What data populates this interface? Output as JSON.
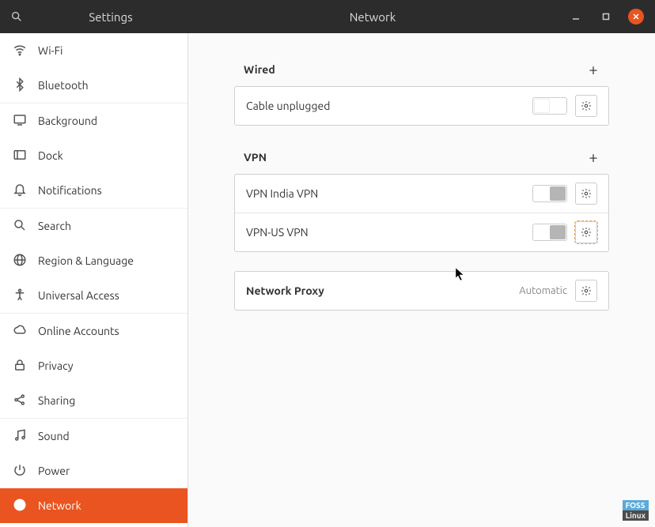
{
  "titlebar": {
    "app_title": "Settings",
    "page_title": "Network"
  },
  "sidebar": {
    "items": [
      {
        "icon": "wifi",
        "label": "Wi-Fi"
      },
      {
        "icon": "bluetooth",
        "label": "Bluetooth"
      },
      {
        "icon": "background",
        "label": "Background"
      },
      {
        "icon": "dock",
        "label": "Dock"
      },
      {
        "icon": "bell",
        "label": "Notifications"
      },
      {
        "icon": "search",
        "label": "Search"
      },
      {
        "icon": "globe",
        "label": "Region & Language"
      },
      {
        "icon": "accessibility",
        "label": "Universal Access"
      },
      {
        "icon": "cloud",
        "label": "Online Accounts"
      },
      {
        "icon": "lock",
        "label": "Privacy"
      },
      {
        "icon": "share",
        "label": "Sharing"
      },
      {
        "icon": "music",
        "label": "Sound"
      },
      {
        "icon": "power",
        "label": "Power"
      },
      {
        "icon": "globe",
        "label": "Network"
      }
    ],
    "active_index": 13
  },
  "sections": {
    "wired": {
      "title": "Wired",
      "rows": [
        {
          "label": "Cable unplugged"
        }
      ]
    },
    "vpn": {
      "title": "VPN",
      "rows": [
        {
          "label": "VPN India VPN"
        },
        {
          "label": "VPN-US VPN"
        }
      ]
    },
    "proxy": {
      "label": "Network Proxy",
      "status": "Automatic"
    }
  },
  "watermark": {
    "line1": "FOSS",
    "line2": "Linux"
  }
}
